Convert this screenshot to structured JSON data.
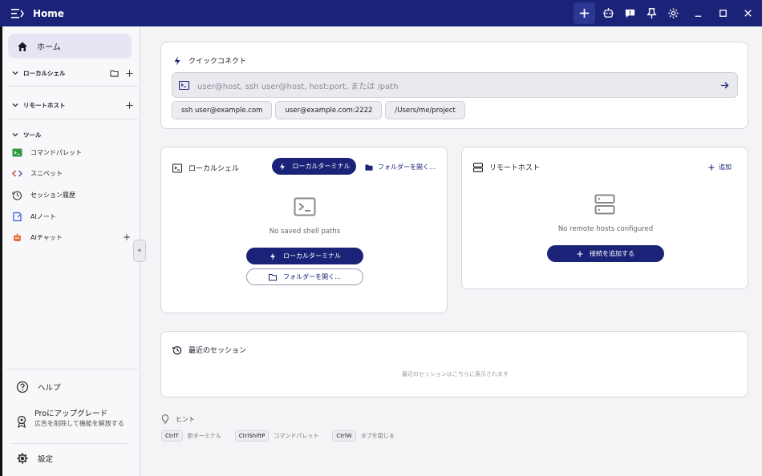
{
  "window": {
    "title": "Home"
  },
  "sidebar": {
    "home_label": "ホーム",
    "local_shell_label": "ローカルシェル",
    "remote_hosts_label": "リモートホスト",
    "tools_label": "ツール",
    "tools": [
      {
        "label": "コマンドパレット"
      },
      {
        "label": "スニペット"
      },
      {
        "label": "セッション履歴"
      },
      {
        "label": "AIノート"
      },
      {
        "label": "AIチャット"
      }
    ],
    "collapse_glyph": "«",
    "help_label": "ヘルプ",
    "upgrade_title": "Proにアップグレード",
    "upgrade_desc": "広告を削除して機能を解放する",
    "settings_label": "設定"
  },
  "quick_connect": {
    "title": "クイックコネクト",
    "placeholder": "user@host, ssh user@host, host:port, または /path",
    "chips": [
      "ssh user@example.com",
      "user@example.com:2222",
      "/Users/me/project"
    ]
  },
  "local_shell_card": {
    "title": "ローカルシェル",
    "terminal_button": "ローカルターミナル",
    "open_folder_link": "フォルダーを開く...",
    "empty_text": "No saved shell paths",
    "terminal_button_2": "ローカルターミナル",
    "open_folder_button": "フォルダーを開く..."
  },
  "remote_hosts_card": {
    "title": "リモートホスト",
    "add_link": "追加",
    "empty_text": "No remote hosts configured",
    "add_connection_button": "接続を追加する"
  },
  "recent_sessions": {
    "title": "最近のセッション",
    "empty_text": "最近のセッションはこちらに表示されます"
  },
  "hints": {
    "title": "ヒント",
    "items": [
      {
        "key": "CtrlT",
        "label": "新ターミナル"
      },
      {
        "key": "CtrlShiftP",
        "label": "コマンドパレット"
      },
      {
        "key": "CtrlW",
        "label": "タブを閉じる"
      }
    ]
  },
  "colors": {
    "accent": "#1a2377",
    "titlebar": "#1a2377",
    "background": "#f4f4f7"
  }
}
